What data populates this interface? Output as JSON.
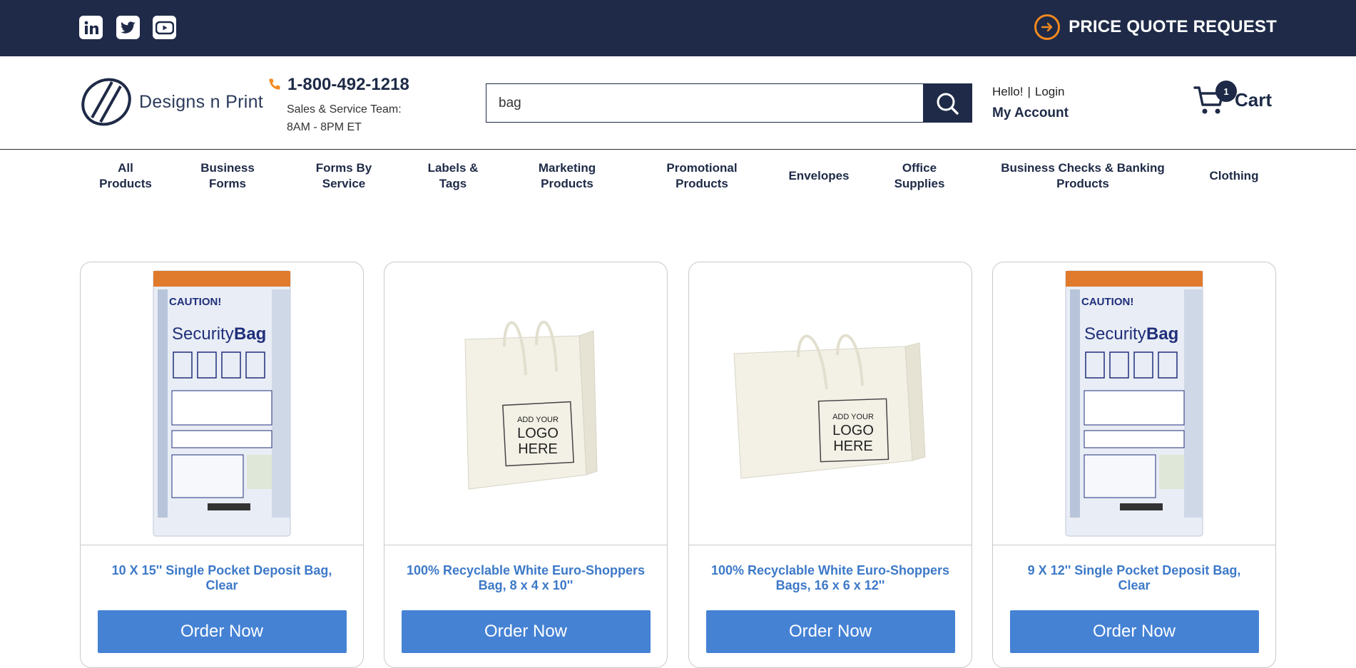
{
  "topbar": {
    "social_icons": [
      "linkedin-icon",
      "twitter-icon",
      "youtube-icon"
    ],
    "quote_label": "PRICE QUOTE REQUEST",
    "accent_color": "#f28a1f",
    "background_color": "#1e2a47"
  },
  "header": {
    "logo_text": "Designs n Print",
    "phone": "1-800-492-1218",
    "team_label": "Sales & Service Team:",
    "hours": "8AM - 8PM ET",
    "search_value": "bag",
    "hello": "Hello!",
    "separator": "|",
    "login": "Login",
    "my_account": "My Account",
    "cart_count": "1",
    "cart_label": "Cart"
  },
  "nav": {
    "items": [
      {
        "line1": "All",
        "line2": "Products"
      },
      {
        "line1": "Business",
        "line2": "Forms"
      },
      {
        "line1": "Forms By",
        "line2": "Service"
      },
      {
        "line1": "Labels &",
        "line2": "Tags"
      },
      {
        "line1": "Marketing",
        "line2": "Products"
      },
      {
        "line1": "Promotional",
        "line2": "Products"
      },
      {
        "line1": "Envelopes",
        "line2": ""
      },
      {
        "line1": "Office",
        "line2": "Supplies"
      },
      {
        "line1": "Business Checks & Banking",
        "line2": "Products"
      },
      {
        "line1": "Clothing",
        "line2": ""
      }
    ]
  },
  "products": [
    {
      "title_line1": "10 X 15'' Single Pocket Deposit Bag,",
      "title_line2": "Clear",
      "button": "Order Now",
      "image": "security-bag-image",
      "img_caution": "CAUTION!",
      "img_word1": "Security",
      "img_word2": "Bag"
    },
    {
      "title_line1": "100% Recyclable White Euro-Shoppers",
      "title_line2": "Bag, 8 x 4 x 10''",
      "button": "Order Now",
      "image": "shopping-bag-image",
      "img_logo1": "ADD YOUR",
      "img_logo2": "LOGO",
      "img_logo3": "HERE"
    },
    {
      "title_line1": "100% Recyclable White Euro-Shoppers",
      "title_line2": "Bags, 16 x 6 x 12''",
      "button": "Order Now",
      "image": "shopping-bag-wide-image",
      "img_logo1": "ADD YOUR",
      "img_logo2": "LOGO",
      "img_logo3": "HERE"
    },
    {
      "title_line1": "9 X 12'' Single Pocket Deposit Bag,",
      "title_line2": "Clear",
      "button": "Order Now",
      "image": "security-bag-image",
      "img_caution": "CAUTION!",
      "img_word1": "Security",
      "img_word2": "Bag"
    }
  ],
  "colors": {
    "link_blue": "#3d79c8",
    "button_blue": "#4582d4",
    "navy": "#1e2a47"
  }
}
